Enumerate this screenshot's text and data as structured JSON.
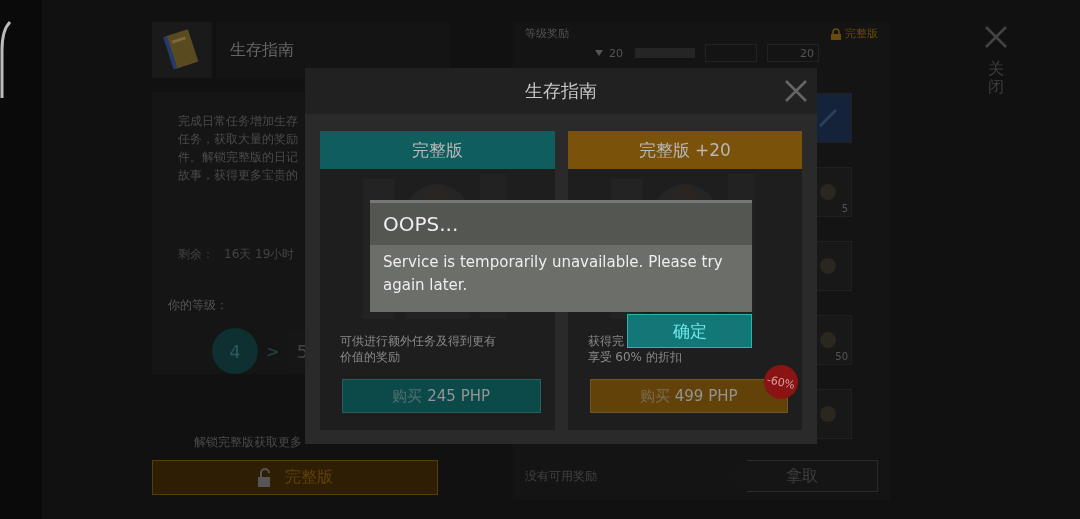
{
  "guide": {
    "title": "生存指南",
    "description_lines": [
      "完成日常任务增加生存",
      "任务，获取大量的奖励",
      "件。解锁完整版的日记",
      "故事，获得更多宝贵的"
    ],
    "remaining_label": "剩余：",
    "remaining": "16天 19小时",
    "level_label": "你的等级：",
    "current_level": "4",
    "level_arrow": ">",
    "next_level": "5",
    "unlock_hint": "解锁完整版获取更多",
    "unlock_button": "完整版"
  },
  "rewards": {
    "title": "等级奖励",
    "locked_label": "完整版",
    "top_counts": [
      "20",
      "20"
    ],
    "slots": [
      {
        "kind": "weapon"
      },
      {
        "kind": "item",
        "count": "5"
      },
      {
        "kind": "item"
      },
      {
        "kind": "item",
        "count": "50"
      },
      {
        "kind": "item"
      }
    ],
    "status": "没有可用奖励",
    "claim_button": "拿取"
  },
  "close": {
    "label": "关闭"
  },
  "modal": {
    "title": "生存指南",
    "plans": [
      {
        "title": "完整版",
        "color": "#0f5d5d",
        "description_lines": [
          "可供进行额外任务及得到更有",
          "价值的奖励"
        ],
        "price_label": "购买",
        "price": "245 PHP"
      },
      {
        "title": "完整版 +20",
        "color": "#7a520a",
        "description_lines": [
          "获得完",
          "享受 60% 的折扣"
        ],
        "price_label": "购买",
        "price": "499 PHP",
        "badge": "-60%"
      }
    ]
  },
  "alert": {
    "title": "OOPS...",
    "message": "Service is temporarily unavailable. Please try again later.",
    "confirm": "确定"
  }
}
